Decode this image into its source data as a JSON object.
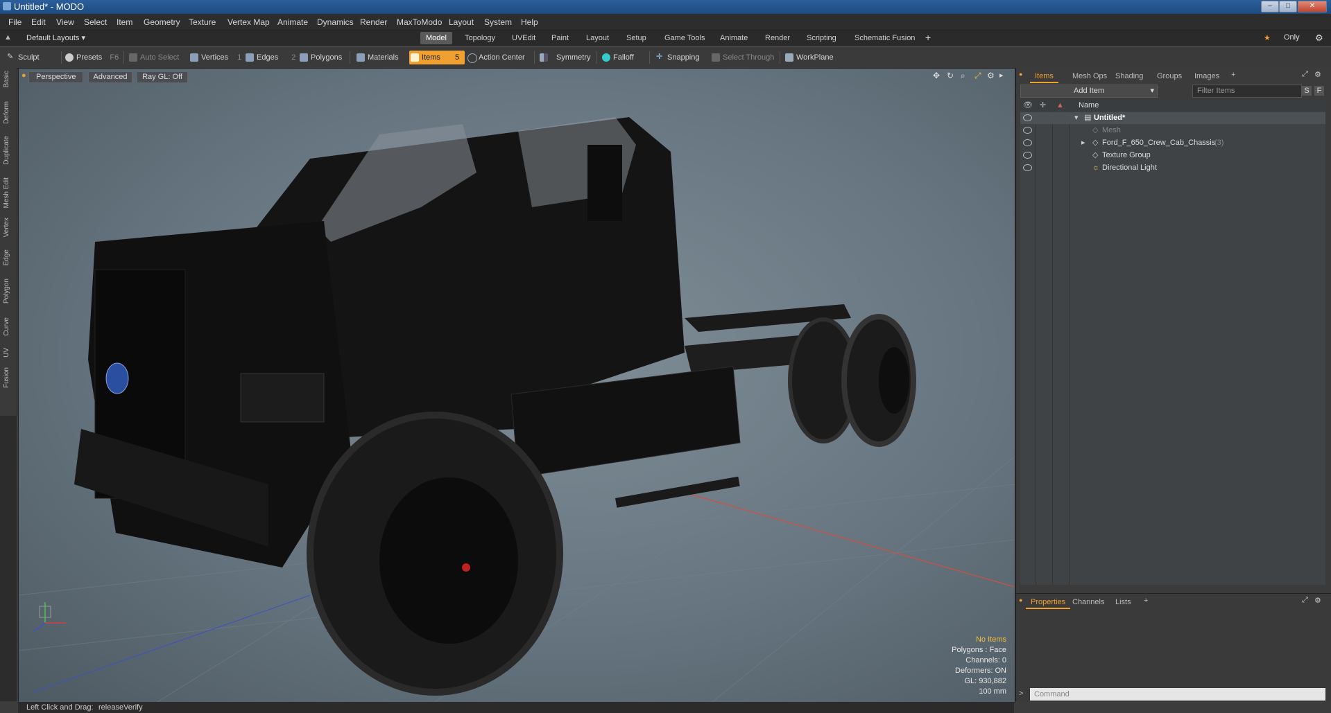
{
  "window": {
    "title": "Untitled* - MODO"
  },
  "menu": [
    "File",
    "Edit",
    "View",
    "Select",
    "Item",
    "Geometry",
    "Texture",
    "Vertex Map",
    "Animate",
    "Dynamics",
    "Render",
    "MaxToModo",
    "Layout",
    "System",
    "Help"
  ],
  "layout_selector": "Default Layouts",
  "layout_tabs": [
    "Model",
    "Topology",
    "UVEdit",
    "Paint",
    "Layout",
    "Setup",
    "Game Tools",
    "Animate",
    "Render",
    "Scripting",
    "Schematic Fusion"
  ],
  "layout_active": "Model",
  "only_label": "Only",
  "toolbar": {
    "sculpt": "Sculpt",
    "presets": "Presets",
    "presets_key": "F6",
    "auto_select": "Auto Select",
    "vertices": "Vertices",
    "vertices_key": "1",
    "edges": "Edges",
    "edges_key": "2",
    "polygons": "Polygons",
    "materials": "Materials",
    "items": "Items",
    "items_key": "5",
    "action_center": "Action Center",
    "symmetry": "Symmetry",
    "falloff": "Falloff",
    "snapping": "Snapping",
    "select_through": "Select Through",
    "workplane": "WorkPlane"
  },
  "left_tabs": [
    "Basic",
    "Deform",
    "Duplicate",
    "Mesh Edit",
    "Vertex",
    "Edge",
    "Polygon",
    "Curve",
    "UV",
    "Fusion"
  ],
  "viewport": {
    "view_mode": "Perspective",
    "advanced": "Advanced",
    "raygl": "Ray GL: Off",
    "info": {
      "selection": "No Items",
      "polygons": "Polygons : Face",
      "channels": "Channels: 0",
      "deformers": "Deformers: ON",
      "gl": "GL: 930,882",
      "scale": "100 mm"
    }
  },
  "right_panel": {
    "tabs": [
      "Items",
      "Mesh Ops",
      "Shading",
      "Groups",
      "Images"
    ],
    "add_item": "Add Item",
    "filter_placeholder": "Filter Items",
    "filter_s": "S",
    "filter_f": "F",
    "name_header": "Name",
    "tree": [
      {
        "label": "Untitled*",
        "bold": true
      },
      {
        "label": "Mesh",
        "dim": true
      },
      {
        "label": "Ford_F_650_Crew_Cab_Chassis",
        "count": "(3)"
      },
      {
        "label": "Texture Group"
      },
      {
        "label": "Directional Light"
      }
    ],
    "bottom_tabs": [
      "Properties",
      "Channels",
      "Lists"
    ],
    "command_placeholder": "Command"
  },
  "statusbar": {
    "left_label": "Left Click and Drag:",
    "action": "releaseVerify"
  },
  "colors": {
    "accent": "#f0a030",
    "titlebar": "#1d4a80",
    "info_highlight": "#f0c040"
  }
}
